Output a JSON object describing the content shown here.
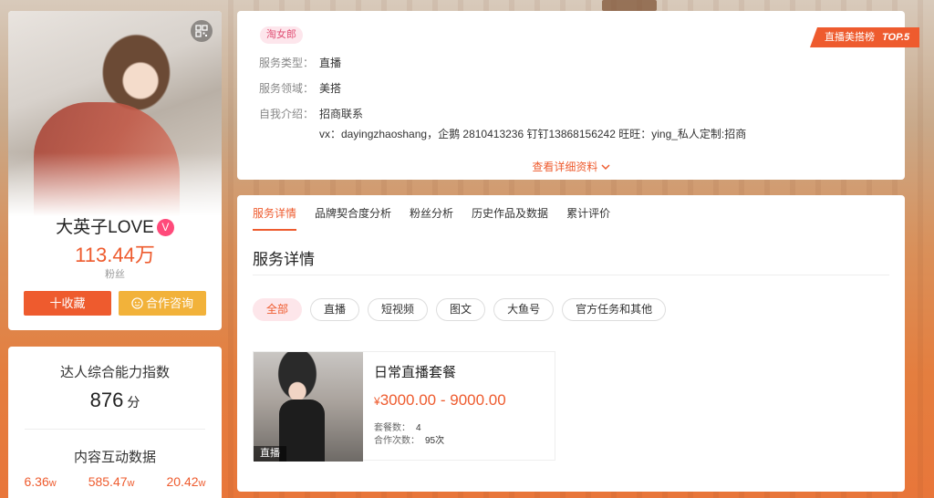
{
  "profile": {
    "name": "大英子LOVE",
    "verified_mark": "V",
    "fans": "113.44万",
    "fans_label": "粉丝",
    "favorite_button": "十收藏",
    "consult_button": "合作咨询",
    "consult_icon": "emoji-face-icon",
    "qr_icon": "qr-code-icon"
  },
  "ability": {
    "title": "达人综合能力指数",
    "score": "876",
    "score_unit": "分",
    "interaction_title": "内容互动数据",
    "stats": [
      {
        "value": "6.36",
        "unit": "w"
      },
      {
        "value": "585.47",
        "unit": "w"
      },
      {
        "value": "20.42",
        "unit": "w"
      }
    ]
  },
  "info": {
    "tag": "淘女郎",
    "rank_label": "直播美搭榜",
    "rank_value": "TOP.5",
    "rows": [
      {
        "label": "服务类型：",
        "value": "直播"
      },
      {
        "label": "服务领域：",
        "value": "美搭"
      },
      {
        "label": "自我介绍：",
        "value": "招商联系"
      }
    ],
    "intro_line2": "vx：dayingzhaoshang，企鹅 2810413236 钉钉13868156242 旺旺：ying_私人定制:招商",
    "detail_link": "查看详细资料",
    "colors": {
      "accent": "#ee5b2e",
      "tag": "#e04f74",
      "gold": "#f2b23a"
    }
  },
  "service": {
    "tabs": [
      "服务详情",
      "品牌契合度分析",
      "粉丝分析",
      "历史作品及数据",
      "累计评价"
    ],
    "active_tab": "服务详情",
    "section_title": "服务详情",
    "filters": [
      "全部",
      "直播",
      "短视频",
      "图文",
      "大鱼号",
      "官方任务和其他"
    ],
    "active_filter": "全部",
    "package": {
      "name": "日常直播套餐",
      "price_symbol": "¥",
      "price": "3000.00 - 9000.00",
      "badge": "直播",
      "count_label": "套餐数：",
      "count": "4",
      "coop_label": "合作次数：",
      "coop": "95次"
    }
  }
}
